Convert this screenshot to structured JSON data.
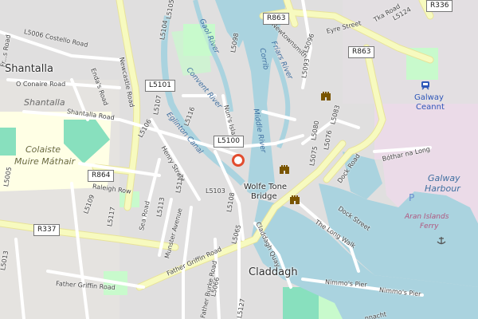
{
  "map": {
    "places": {
      "shantalla_big": "Shantalla",
      "shantalla_small": "Shantalla",
      "claddagh": "Claddagh",
      "wolfe_tone_bridge_1": "Wolfe Tone",
      "wolfe_tone_bridge_2": "Bridge",
      "galway_ceannt_1": "Galway",
      "galway_ceannt_2": "Ceannt",
      "galway_harbour_1": "Galway",
      "galway_harbour_2": "Harbour",
      "aran_ferry_1": "Aran Islands",
      "aran_ferry_2": "Ferry",
      "school_1": "Colaiste",
      "school_2": "Muire Máthair"
    },
    "waterways": {
      "corrib": "Corrib",
      "friars_river": "Friars River",
      "middle_river": "Middle River",
      "eglinton_canal": "Eglinton Canal",
      "convent_river": "Convent River",
      "gaol_river": "Gaol River"
    },
    "streets": {
      "newcastle_road": "Newcastle Road",
      "costello_road": "L5006 Costello Road",
      "oconaire_road": "O Conaire Road",
      "endas_road": "Enda's Road",
      "shantalla_road": "Shantalla Road",
      "raleigh_row": "Raleigh Row",
      "henry_street": "Henry Street",
      "sea_road": "Sea Road",
      "munster_avenue": "Munster Avenue",
      "father_griffin_road": "Father Griffin Road",
      "father_griffin_road_2": "Father Griffin Road",
      "father_burke_road": "Father Burke Road",
      "claddagh_quay": "Claddagh Quay",
      "dock_road": "Dock Road",
      "dock_street": "Dock Street",
      "bothar_na_long": "Bóthar na Long",
      "the_long_walk": "The Long Walk",
      "nimmos_pier": "Nimmo's Pier",
      "nimmos_pier_2": "Nimmo's Pier",
      "eyre_street": "Eyre Street",
      "newtownsmith": "Newtownsmith",
      "nuns_island": "Nun's Island",
      "fr_road": "Fr...s Road",
      "tka_road": "Tka Road",
      "nnacht": "nnacht",
      "street_l5006": "L5006",
      "street_l5101": "L5101"
    },
    "roads": {
      "r863_a": "R863",
      "r863_b": "R863",
      "r336": "R336",
      "r864": "R864",
      "r337": "R337",
      "l5101": "L5101",
      "l5100": "L5100",
      "l5103": "L5103",
      "l5106": "L5106",
      "l5107": "L5107",
      "l5108": "L5108",
      "l5109": "L5109",
      "l5112": "L5112",
      "l5113": "L5113",
      "l5116": "L5116",
      "l5117": "L5117",
      "l5065": "L5065",
      "l5066": "L5066",
      "l5075": "L5075",
      "l5076": "L5076",
      "l5080": "L5080",
      "l5083": "L5083",
      "l5093": "L5093",
      "l5096": "L5096",
      "l5098": "L5098",
      "l5104": "L5104",
      "l5105": "L5105",
      "l5124": "L5124",
      "l5127": "L5127",
      "l5013": "L5013",
      "l5005": "L5005"
    },
    "colors": {
      "water": "#aad3df",
      "land": "#f2efe9",
      "residential": "#e0dfdf",
      "primary_road": "#fcd6a4",
      "secondary_road": "#f7fabf",
      "park": "#c8facc",
      "pitch": "#88e0be",
      "school": "#ffffe5",
      "marker": "#e24c2e",
      "castle_icon": "#7a5500"
    }
  }
}
